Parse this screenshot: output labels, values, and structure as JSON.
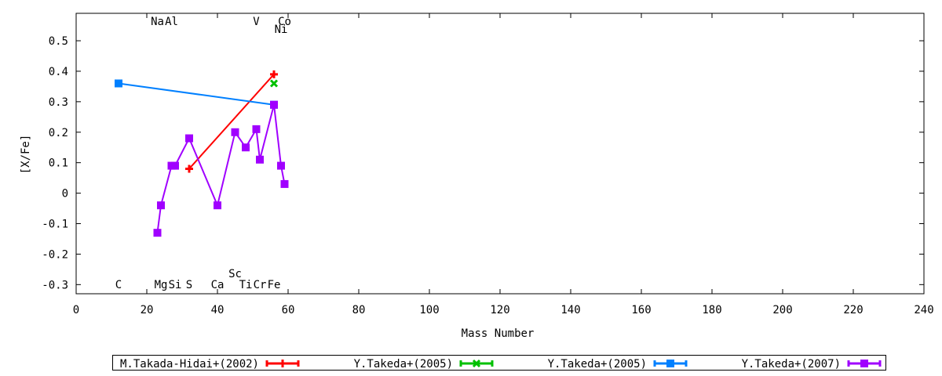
{
  "chart_data": {
    "type": "line",
    "title": "",
    "xlabel": "Mass Number",
    "ylabel": "[X/Fe]",
    "xlim": [
      0,
      240
    ],
    "ylim": [
      -0.33,
      0.59
    ],
    "x_ticks": [
      0,
      20,
      40,
      60,
      80,
      100,
      120,
      140,
      160,
      180,
      200,
      220,
      240
    ],
    "y_ticks": [
      -0.3,
      -0.2,
      -0.1,
      0,
      0.1,
      0.2,
      0.3,
      0.4,
      0.5
    ],
    "y_tick_labels": [
      "-0.3",
      "-0.2",
      "-0.1",
      "0",
      "0.1",
      "0.2",
      "0.3",
      "0.4",
      "0.5"
    ],
    "grid": false,
    "legend_position": "bottom",
    "element_labels": [
      {
        "symbol": "C",
        "mass": 12,
        "row": "bottom"
      },
      {
        "symbol": "Na",
        "mass": 23,
        "row": "top"
      },
      {
        "symbol": "Mg",
        "mass": 24,
        "row": "bottom"
      },
      {
        "symbol": "Al",
        "mass": 27,
        "row": "top"
      },
      {
        "symbol": "Si",
        "mass": 28,
        "row": "bottom"
      },
      {
        "symbol": "S",
        "mass": 32,
        "row": "bottom"
      },
      {
        "symbol": "Ca",
        "mass": 40,
        "row": "bottom"
      },
      {
        "symbol": "Sc",
        "mass": 45,
        "row": "bottom-upper"
      },
      {
        "symbol": "Ti",
        "mass": 48,
        "row": "bottom"
      },
      {
        "symbol": "V",
        "mass": 51,
        "row": "top"
      },
      {
        "symbol": "Cr",
        "mass": 52,
        "row": "bottom"
      },
      {
        "symbol": "Fe",
        "mass": 56,
        "row": "bottom"
      },
      {
        "symbol": "Co",
        "mass": 59,
        "row": "top"
      },
      {
        "symbol": "Ni",
        "mass": 58,
        "row": "top-lower"
      }
    ],
    "series": [
      {
        "name": "M.Takada-Hidai+(2002)",
        "color": "#ff0000",
        "marker": "plus",
        "x": [
          32,
          56
        ],
        "y": [
          0.08,
          0.39
        ]
      },
      {
        "name": "Y.Takeda+(2005)",
        "color": "#00c000",
        "marker": "cross",
        "x": [
          56
        ],
        "y": [
          0.36
        ]
      },
      {
        "name": "Y.Takeda+(2005)",
        "color": "#0080ff",
        "marker": "square",
        "x": [
          12,
          56
        ],
        "y": [
          0.36,
          0.29
        ]
      },
      {
        "name": "Y.Takeda+(2007)",
        "color": "#a000ff",
        "marker": "square",
        "x": [
          23,
          24,
          27,
          28,
          32,
          40,
          45,
          48,
          51,
          52,
          56,
          58,
          59
        ],
        "y": [
          -0.13,
          -0.04,
          0.09,
          0.09,
          0.18,
          -0.04,
          0.2,
          0.15,
          0.21,
          0.11,
          0.29,
          0.09,
          0.03
        ]
      }
    ]
  }
}
